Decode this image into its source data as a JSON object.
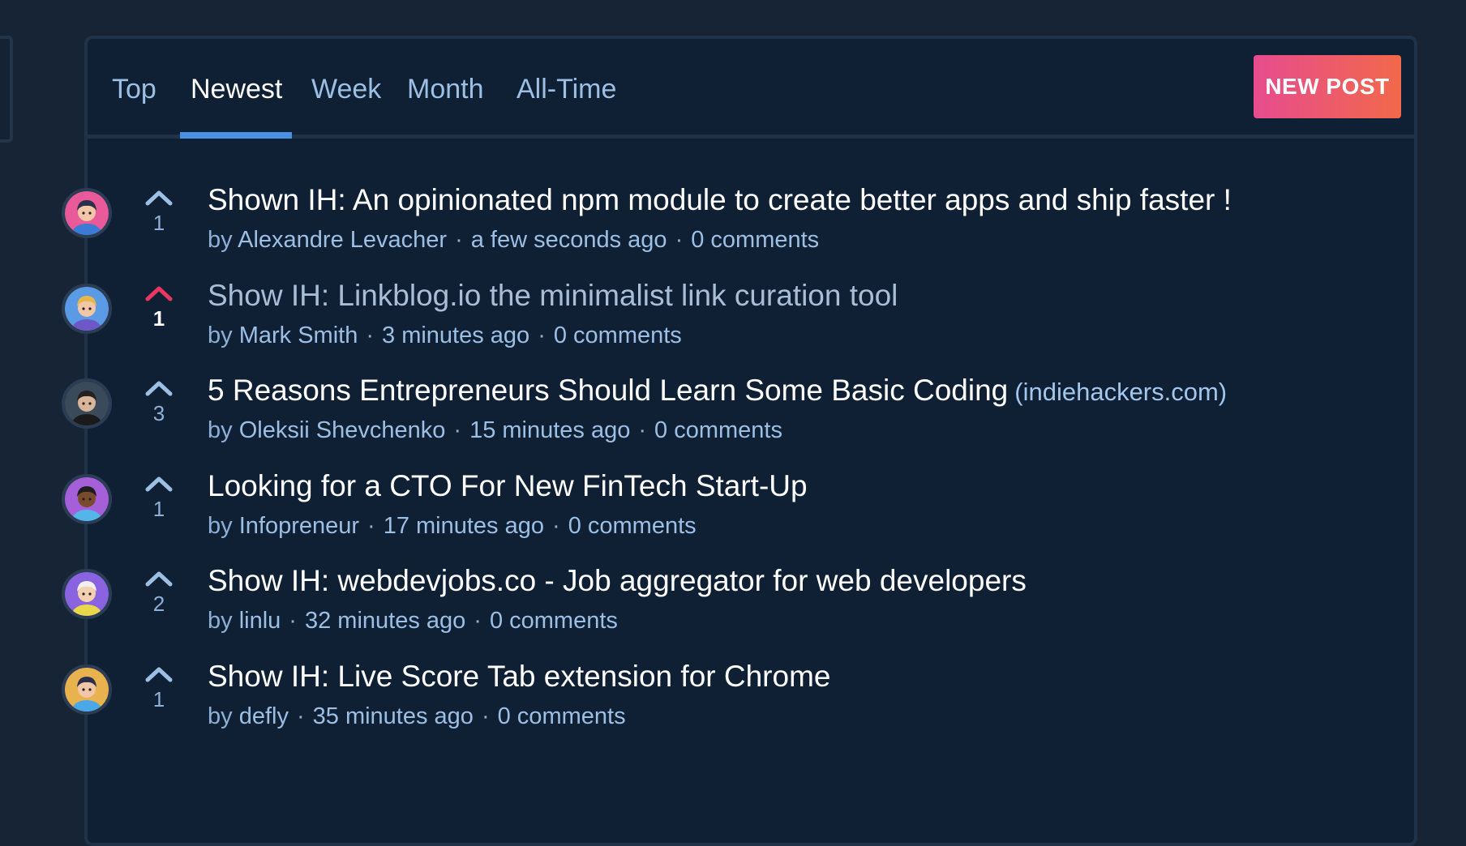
{
  "tabs": [
    {
      "label": "Top",
      "active": false
    },
    {
      "label": "Newest",
      "active": true
    },
    {
      "label": "Week",
      "active": false
    },
    {
      "label": "Month",
      "active": false
    },
    {
      "label": "All-Time",
      "active": false
    }
  ],
  "new_post_label": "NEW POST",
  "colors": {
    "accent": "#4a90e2",
    "upvoted": "#e8385f",
    "new_post_from": "#e64c8e",
    "new_post_to": "#f2684a"
  },
  "posts": [
    {
      "title": "Shown IH: An opinionated npm module to create better apps and ship faster !",
      "domain": "",
      "author_prefix": "by",
      "author": "Alexandre Levacher",
      "time": "a few seconds ago",
      "comments": "0 comments",
      "votes": "1",
      "upvoted": false,
      "visited": false,
      "avatar_icon": "avatar-icon"
    },
    {
      "title": "Show IH: Linkblog.io the minimalist link curation tool",
      "domain": "",
      "author_prefix": "by",
      "author": "Mark Smith",
      "time": "3 minutes ago",
      "comments": "0 comments",
      "votes": "1",
      "upvoted": true,
      "visited": true,
      "avatar_icon": "avatar-icon"
    },
    {
      "title": "5 Reasons Entrepreneurs Should Learn Some Basic Coding",
      "domain": "(indiehackers.com)",
      "author_prefix": "by",
      "author": "Oleksii Shevchenko",
      "time": "15 minutes ago",
      "comments": "0 comments",
      "votes": "3",
      "upvoted": false,
      "visited": false,
      "avatar_icon": "avatar-photo-icon"
    },
    {
      "title": "Looking for a CTO For New FinTech Start-Up",
      "domain": "",
      "author_prefix": "by",
      "author": "Infopreneur",
      "time": "17 minutes ago",
      "comments": "0 comments",
      "votes": "1",
      "upvoted": false,
      "visited": false,
      "avatar_icon": "avatar-icon"
    },
    {
      "title": "Show IH: webdevjobs.co - Job aggregator for web developers",
      "domain": "",
      "author_prefix": "by",
      "author": "linlu",
      "time": "32 minutes ago",
      "comments": "0 comments",
      "votes": "2",
      "upvoted": false,
      "visited": false,
      "avatar_icon": "avatar-icon"
    },
    {
      "title": "Show IH: Live Score Tab extension for Chrome",
      "domain": "",
      "author_prefix": "by",
      "author": "defly",
      "time": "35 minutes ago",
      "comments": "0 comments",
      "votes": "1",
      "upvoted": false,
      "visited": false,
      "avatar_icon": "avatar-icon"
    }
  ]
}
